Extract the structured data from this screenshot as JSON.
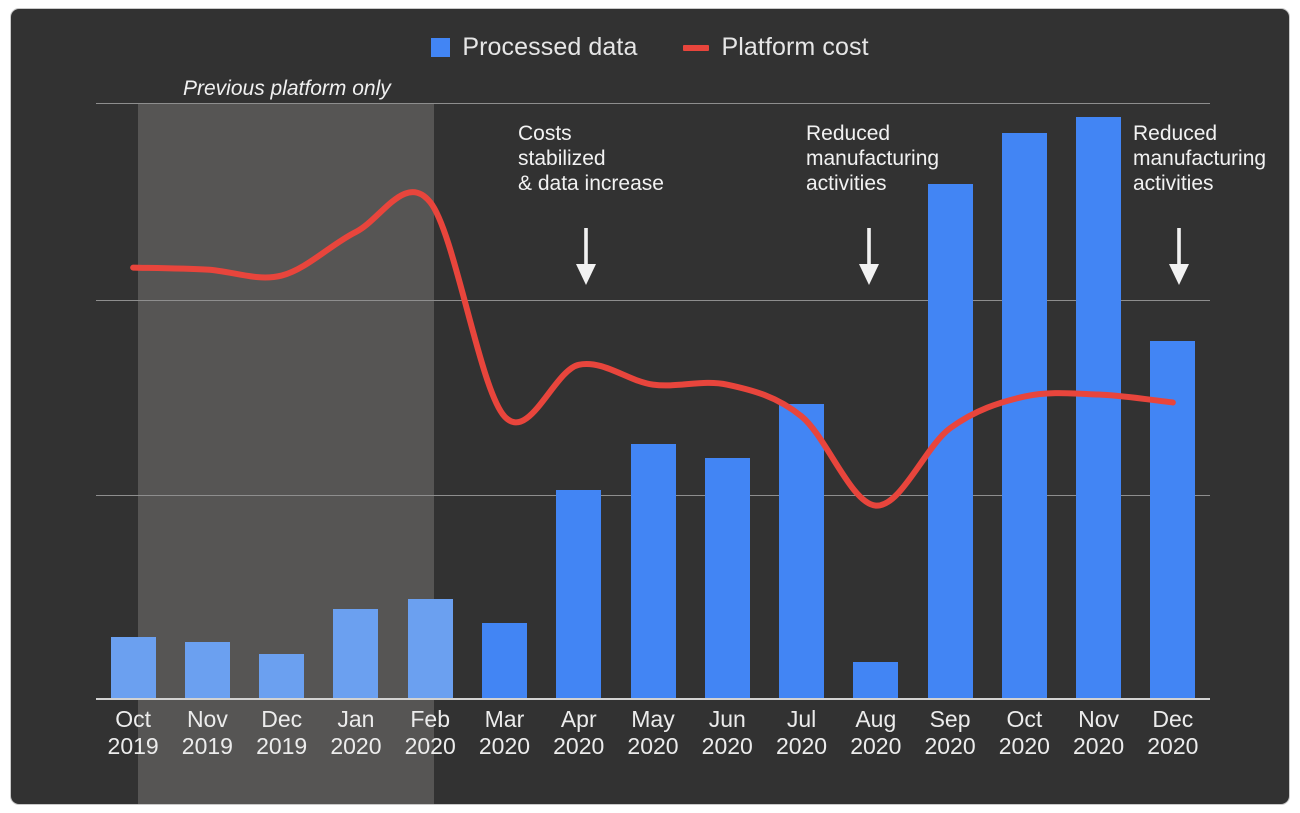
{
  "legend": {
    "items": [
      {
        "label": "Processed data",
        "marker": "bar-swatch-icon",
        "color": "#4285f4"
      },
      {
        "label": "Platform cost",
        "marker": "line-swatch-icon",
        "color": "#e8453c"
      }
    ]
  },
  "shaded_region": {
    "note": "Previous platform only",
    "from": "Oct 2019",
    "to": "Feb 2020"
  },
  "annotations": [
    {
      "text": "Costs\nstabilized\n& data increase",
      "points_to": "Apr 2020",
      "arrow": "down-arrow-icon"
    },
    {
      "text": "Reduced\nmanufacturing\nactivities",
      "points_to": "Aug 2020",
      "arrow": "down-arrow-icon"
    },
    {
      "text": "Reduced\nmanufacturing\nactivities",
      "points_to": "Dec 2020",
      "arrow": "down-arrow-icon"
    }
  ],
  "chart_data": {
    "type": "bar",
    "title": "",
    "xlabel": "",
    "ylabel": "",
    "grid": true,
    "legend_position": "top-center",
    "axis": {
      "y_gridlines": [
        3,
        2,
        1,
        0
      ],
      "y_tick_labels": [],
      "ylim": [
        0,
        3
      ]
    },
    "categories": [
      "Oct 2019",
      "Nov 2019",
      "Dec 2019",
      "Jan 2020",
      "Feb 2020",
      "Mar 2020",
      "Apr 2020",
      "May 2020",
      "Jun 2020",
      "Jul 2020",
      "Aug 2020",
      "Sep 2020",
      "Oct 2020",
      "Nov 2020",
      "Dec 2020"
    ],
    "category_months": [
      "Oct",
      "Nov",
      "Dec",
      "Jan",
      "Feb",
      "Mar",
      "Apr",
      "May",
      "Jun",
      "Jul",
      "Aug",
      "Sep",
      "Oct",
      "Nov",
      "Dec"
    ],
    "category_years": [
      "2019",
      "2019",
      "2019",
      "2020",
      "2020",
      "2020",
      "2020",
      "2020",
      "2020",
      "2020",
      "2020",
      "2020",
      "2020",
      "2020",
      "2020"
    ],
    "series": [
      {
        "name": "Processed data",
        "type": "bar",
        "color": "#4285f4",
        "values": [
          0.31,
          0.28,
          0.22,
          0.45,
          0.5,
          0.38,
          1.05,
          1.28,
          1.21,
          1.48,
          0.18,
          2.59,
          2.85,
          2.93,
          1.8
        ]
      },
      {
        "name": "Platform cost",
        "type": "line",
        "color": "#e8453c",
        "values": [
          2.17,
          2.16,
          2.13,
          2.35,
          2.5,
          1.42,
          1.68,
          1.58,
          1.58,
          1.42,
          0.97,
          1.36,
          1.52,
          1.53,
          1.49
        ]
      }
    ]
  }
}
